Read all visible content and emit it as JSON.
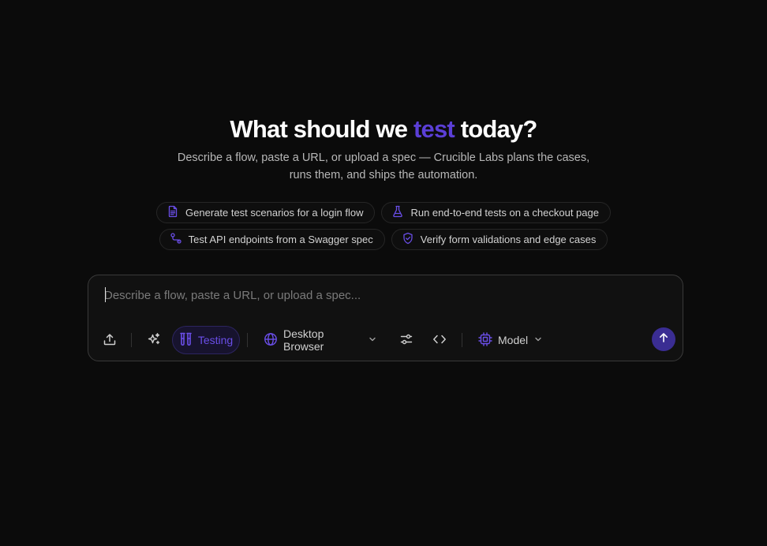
{
  "hero": {
    "title_before": "What should we ",
    "title_accent": "test",
    "title_after": " today?",
    "subtitle_line1": "Describe a flow, paste a URL, or upload a spec — Crucible Labs plans the cases,",
    "subtitle_line2": "runs them, and ships the automation."
  },
  "suggestions": [
    {
      "label": "Generate test scenarios for a login flow",
      "icon": "document-icon"
    },
    {
      "label": "Run end-to-end tests on a checkout page",
      "icon": "flask-icon"
    },
    {
      "label": "Test API endpoints from a Swagger spec",
      "icon": "api-route-icon"
    },
    {
      "label": "Verify form validations and edge cases",
      "icon": "shield-check-icon"
    }
  ],
  "composer": {
    "placeholder": "Describe a flow, paste a URL, or upload a spec...",
    "value": ""
  },
  "toolbar": {
    "testing_label": "Testing",
    "device_label": "Desktop Browser",
    "model_label": "Model"
  },
  "colors": {
    "accent": "#5b3fd6",
    "send_button": "#3a2d93",
    "background": "#0b0b0b"
  }
}
